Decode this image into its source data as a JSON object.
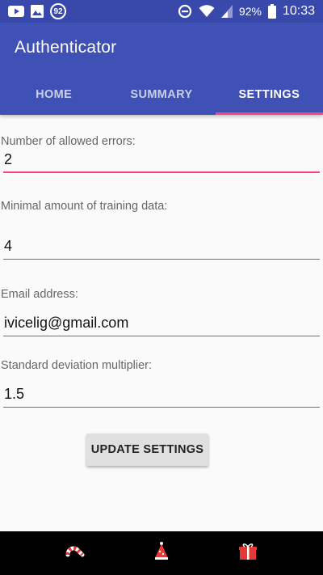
{
  "status_bar": {
    "notification_badge": "92",
    "battery": "92%",
    "time": "10:33",
    "icons": [
      "youtube-icon",
      "image-icon",
      "notification-count-icon",
      "data-saver-icon",
      "wifi-icon",
      "signal-icon",
      "battery-icon"
    ]
  },
  "app": {
    "title": "Authenticator",
    "primary_color": "#3f51b5",
    "accent_color": "#ff4081"
  },
  "tabs": [
    {
      "label": "HOME",
      "active": false
    },
    {
      "label": "SUMMARY",
      "active": false
    },
    {
      "label": "SETTINGS",
      "active": true
    }
  ],
  "settings": {
    "allowed_errors_label": "Number of allowed errors:",
    "allowed_errors_value": "2",
    "training_data_label": "Minimal amount of training data:",
    "training_data_value": "4",
    "email_label": "Email address:",
    "email_value": "ivicelig@gmail.com",
    "std_dev_label": "Standard deviation multiplier:",
    "std_dev_value": "1.5",
    "update_button": "UPDATE SETTINGS"
  },
  "nav_bar": {
    "icons": [
      "candy-cane-back-icon",
      "christmas-tree-home-icon",
      "gift-recents-icon"
    ]
  }
}
